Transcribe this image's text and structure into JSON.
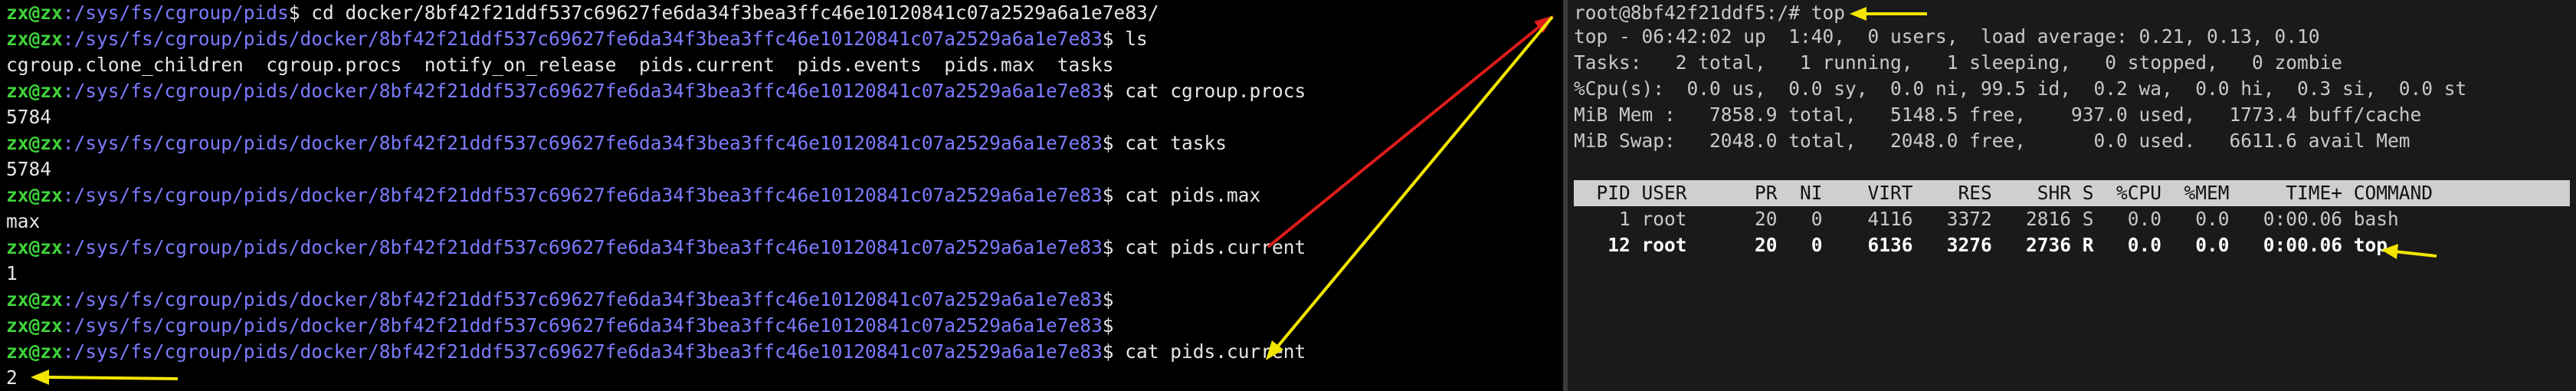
{
  "left_terminal": {
    "prompt_user": "zx@zx",
    "lines": [
      {
        "kind": "prompt",
        "path": ":/sys/fs/cgroup/pids",
        "cmd": "$ cd docker/8bf42f21ddf537c69627fe6da34f3bea3ffc46e10120841c07a2529a6a1e7e83/"
      },
      {
        "kind": "prompt",
        "path": ":/sys/fs/cgroup/pids/docker/8bf42f21ddf537c69627fe6da34f3bea3ffc46e10120841c07a2529a6a1e7e83",
        "cmd": "$ ls"
      },
      {
        "kind": "output",
        "text": "cgroup.clone_children  cgroup.procs  notify_on_release  pids.current  pids.events  pids.max  tasks"
      },
      {
        "kind": "prompt",
        "path": ":/sys/fs/cgroup/pids/docker/8bf42f21ddf537c69627fe6da34f3bea3ffc46e10120841c07a2529a6a1e7e83",
        "cmd": "$ cat cgroup.procs"
      },
      {
        "kind": "output",
        "text": "5784"
      },
      {
        "kind": "prompt",
        "path": ":/sys/fs/cgroup/pids/docker/8bf42f21ddf537c69627fe6da34f3bea3ffc46e10120841c07a2529a6a1e7e83",
        "cmd": "$ cat tasks"
      },
      {
        "kind": "output",
        "text": "5784"
      },
      {
        "kind": "prompt",
        "path": ":/sys/fs/cgroup/pids/docker/8bf42f21ddf537c69627fe6da34f3bea3ffc46e10120841c07a2529a6a1e7e83",
        "cmd": "$ cat pids.max"
      },
      {
        "kind": "output",
        "text": "max"
      },
      {
        "kind": "prompt",
        "path": ":/sys/fs/cgroup/pids/docker/8bf42f21ddf537c69627fe6da34f3bea3ffc46e10120841c07a2529a6a1e7e83",
        "cmd": "$ cat pids.current"
      },
      {
        "kind": "output",
        "text": "1"
      },
      {
        "kind": "prompt",
        "path": ":/sys/fs/cgroup/pids/docker/8bf42f21ddf537c69627fe6da34f3bea3ffc46e10120841c07a2529a6a1e7e83",
        "cmd": "$"
      },
      {
        "kind": "prompt",
        "path": ":/sys/fs/cgroup/pids/docker/8bf42f21ddf537c69627fe6da34f3bea3ffc46e10120841c07a2529a6a1e7e83",
        "cmd": "$"
      },
      {
        "kind": "prompt",
        "path": ":/sys/fs/cgroup/pids/docker/8bf42f21ddf537c69627fe6da34f3bea3ffc46e10120841c07a2529a6a1e7e83",
        "cmd": "$ cat pids.current"
      },
      {
        "kind": "output",
        "text": "2"
      }
    ]
  },
  "right_terminal": {
    "prompt": "root@8bf42f21ddf5:/# top",
    "summary": [
      "top - 06:42:02 up  1:40,  0 users,  load average: 0.21, 0.13, 0.10",
      "Tasks:   2 total,   1 running,   1 sleeping,   0 stopped,   0 zombie",
      "%Cpu(s):  0.0 us,  0.0 sy,  0.0 ni, 99.5 id,  0.2 wa,  0.0 hi,  0.3 si,  0.0 st",
      "MiB Mem :   7858.9 total,   5148.5 free,    937.0 used,   1773.4 buff/cache",
      "MiB Swap:   2048.0 total,   2048.0 free,      0.0 used.   6611.6 avail Mem"
    ],
    "table_header": "  PID USER      PR  NI    VIRT    RES    SHR S  %CPU  %MEM     TIME+ COMMAND",
    "processes": [
      {
        "text": "    1 root      20   0    4116   3372   2816 S   0.0   0.0   0:00.06 bash",
        "highlight": false
      },
      {
        "text": "   12 root      20   0    6136   3276   2736 R   0.0   0.0   0:00.06 top",
        "highlight": true
      }
    ]
  },
  "annotation_colors": {
    "red": "#e01b1b",
    "yellow": "#f2e600"
  }
}
